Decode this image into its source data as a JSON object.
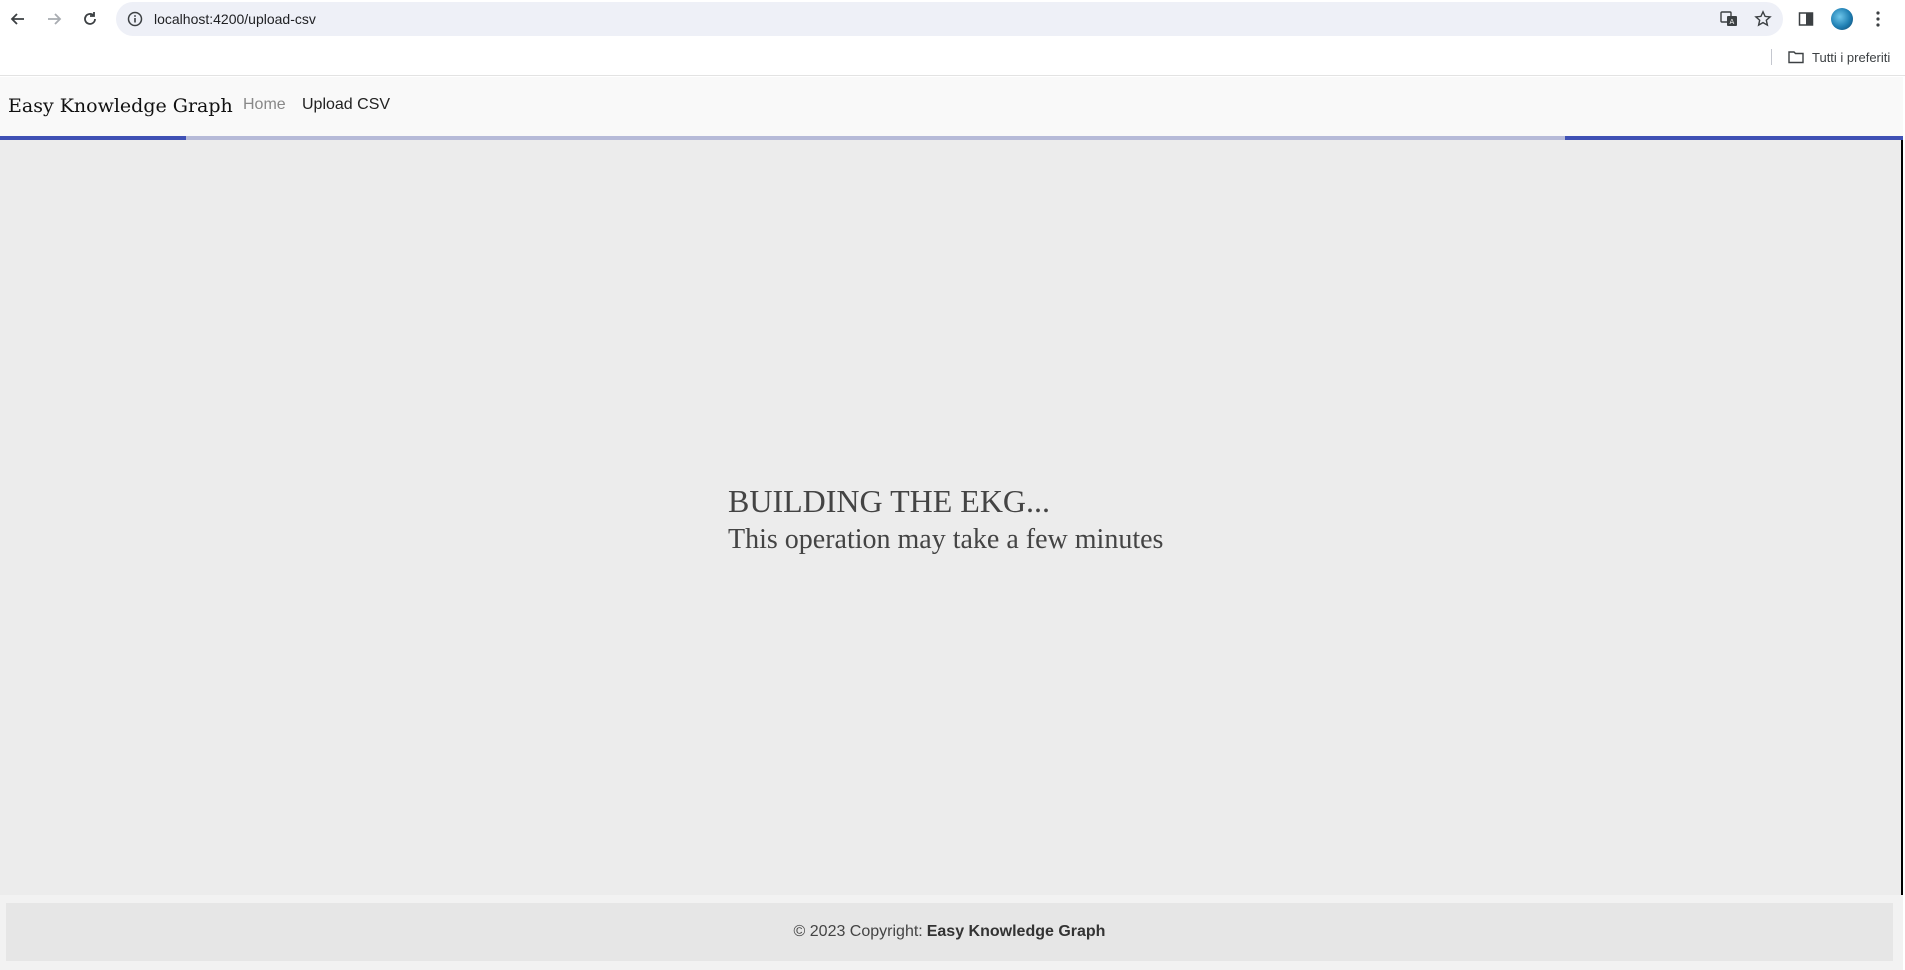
{
  "browser": {
    "url": "localhost:4200/upload-csv",
    "bookmarks_folder": "Tutti i preferiti"
  },
  "navbar": {
    "brand": "Easy Knowledge Graph",
    "links": [
      {
        "label": "Home"
      },
      {
        "label": "Upload CSV"
      }
    ]
  },
  "loading": {
    "title": "BUILDING THE EKG...",
    "subtitle": "This operation may take a few minutes",
    "progress_color": "#3f51b5"
  },
  "footer": {
    "prefix": "© 2023 Copyright:",
    "brand": "Easy Knowledge Graph"
  }
}
